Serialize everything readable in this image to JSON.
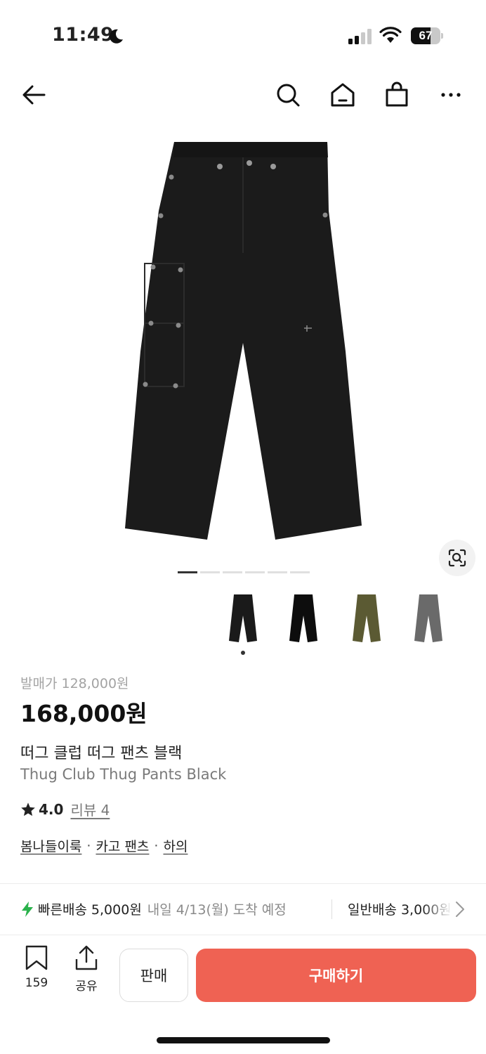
{
  "status_bar": {
    "time": "11:49",
    "battery": "67",
    "battery_level": 0.67
  },
  "nav": {
    "back_icon": "arrow-left-icon",
    "icons": [
      "search-icon",
      "home-icon",
      "shopping-bag-icon",
      "more-icon"
    ]
  },
  "gallery": {
    "page_count": 6,
    "current_page": 1,
    "thumbnails": [
      {
        "color_name": "black",
        "color": "#1a1a1a"
      },
      {
        "color_name": "black-alt",
        "color": "#0d0d0d"
      },
      {
        "color_name": "olive",
        "color": "#5b5a33"
      },
      {
        "color_name": "gray",
        "color": "#6a6a6a"
      }
    ],
    "selected_thumbnail": 1
  },
  "product": {
    "retail_price": "발매가 128,000원",
    "price": "168,000원",
    "name_ko": "떠그 클럽 떠그 팬츠 블랙",
    "name_en": "Thug Club Thug Pants Black",
    "rating": "4.0",
    "rating_stars": 4.0,
    "reviews": "리뷰 4",
    "categories": [
      "봄나들이룩",
      "카고 팬츠",
      "하의"
    ],
    "category_separator": "·"
  },
  "shipping": {
    "fast_label": "빠른배송",
    "fast_fee": "5,000원",
    "fast_eta": "내일 4/13(월) 도착 예정",
    "normal": "일반배송 3,000원",
    "accent_color": "#2bb24c"
  },
  "bottom_bar": {
    "bookmark_count": "159",
    "share_label": "공유",
    "sell_label": "판매",
    "buy_label": "구매하기",
    "buy_color": "#ef6253"
  }
}
